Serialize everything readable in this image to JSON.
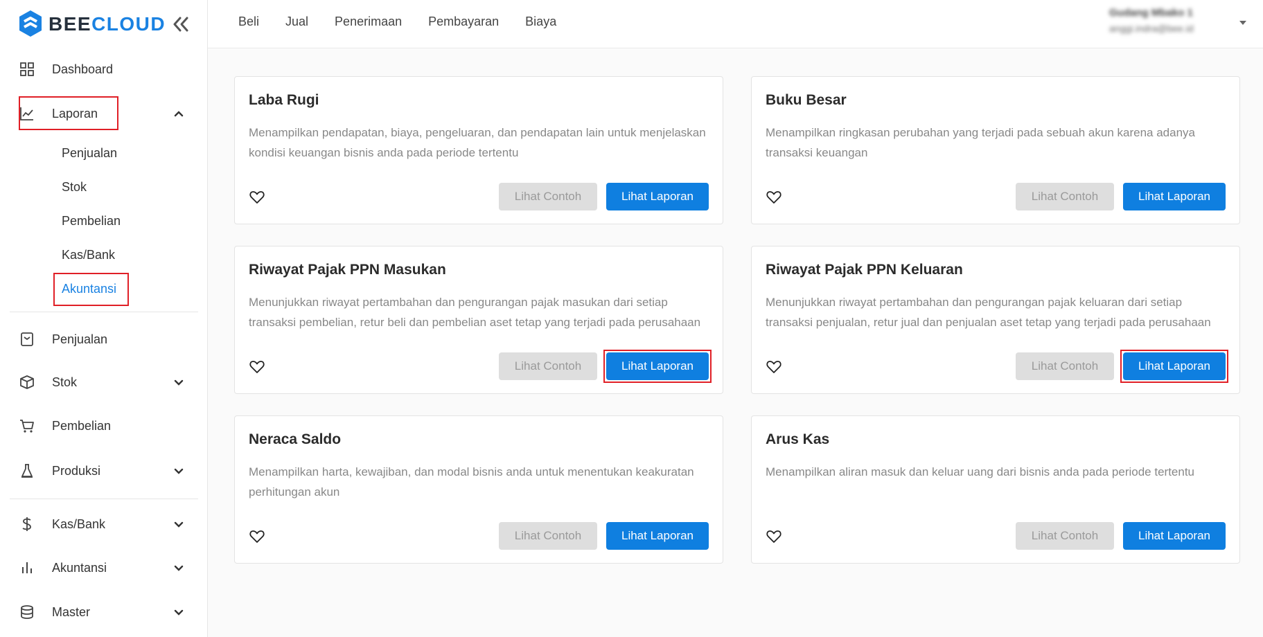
{
  "brand": {
    "part1": "BEE",
    "part2": "CLOUD"
  },
  "colors": {
    "accent": "#1a82e2",
    "highlight": "#e01f26",
    "button_primary": "#0f7fe0",
    "button_disabled": "#dedede"
  },
  "sidebar": {
    "items": [
      {
        "label": "Dashboard",
        "icon": "grid-icon"
      },
      {
        "label": "Laporan",
        "icon": "line-chart-icon",
        "expanded": true
      },
      {
        "label": "Penjualan",
        "icon": "receipt-icon"
      },
      {
        "label": "Stok",
        "icon": "box-icon"
      },
      {
        "label": "Pembelian",
        "icon": "cart-icon"
      },
      {
        "label": "Produksi",
        "icon": "flask-icon"
      },
      {
        "label": "Kas/Bank",
        "icon": "dollar-icon"
      },
      {
        "label": "Akuntansi",
        "icon": "bar-chart-icon"
      },
      {
        "label": "Master",
        "icon": "database-icon"
      }
    ],
    "laporan_sub": [
      "Penjualan",
      "Stok",
      "Pembelian",
      "Kas/Bank",
      "Akuntansi"
    ],
    "active_sub": "Akuntansi"
  },
  "topnav": [
    "Beli",
    "Jual",
    "Penerimaan",
    "Pembayaran",
    "Biaya"
  ],
  "user": {
    "name": "Gudang Mbako 1",
    "email": "anggi.indra@bee.id"
  },
  "cards": [
    {
      "title": "Laba Rugi",
      "desc": "Menampilkan pendapatan, biaya, pengeluaran, dan pendapatan lain untuk menjelaskan kondisi keuangan bisnis anda pada periode tertentu",
      "sample": "Lihat Contoh",
      "report": "Lihat Laporan",
      "highlighted": false
    },
    {
      "title": "Buku Besar",
      "desc": "Menampilkan ringkasan perubahan yang terjadi pada sebuah akun karena adanya transaksi keuangan",
      "sample": "Lihat Contoh",
      "report": "Lihat Laporan",
      "highlighted": false
    },
    {
      "title": "Riwayat Pajak PPN Masukan",
      "desc": "Menunjukkan riwayat pertambahan dan pengurangan pajak masukan dari setiap transaksi pembelian, retur beli dan pembelian aset tetap yang terjadi pada perusahaan",
      "sample": "Lihat Contoh",
      "report": "Lihat Laporan",
      "highlighted": true
    },
    {
      "title": "Riwayat Pajak PPN Keluaran",
      "desc": "Menunjukkan riwayat pertambahan dan pengurangan pajak keluaran dari setiap transaksi penjualan, retur jual dan penjualan aset tetap yang terjadi pada perusahaan",
      "sample": "Lihat Contoh",
      "report": "Lihat Laporan",
      "highlighted": true
    },
    {
      "title": "Neraca Saldo",
      "desc": "Menampilkan harta, kewajiban, dan modal bisnis anda untuk menentukan keakuratan perhitungan akun",
      "sample": "Lihat Contoh",
      "report": "Lihat Laporan",
      "highlighted": false
    },
    {
      "title": "Arus Kas",
      "desc": "Menampilkan aliran masuk dan keluar uang dari bisnis anda pada periode tertentu",
      "sample": "Lihat Contoh",
      "report": "Lihat Laporan",
      "highlighted": false
    }
  ]
}
